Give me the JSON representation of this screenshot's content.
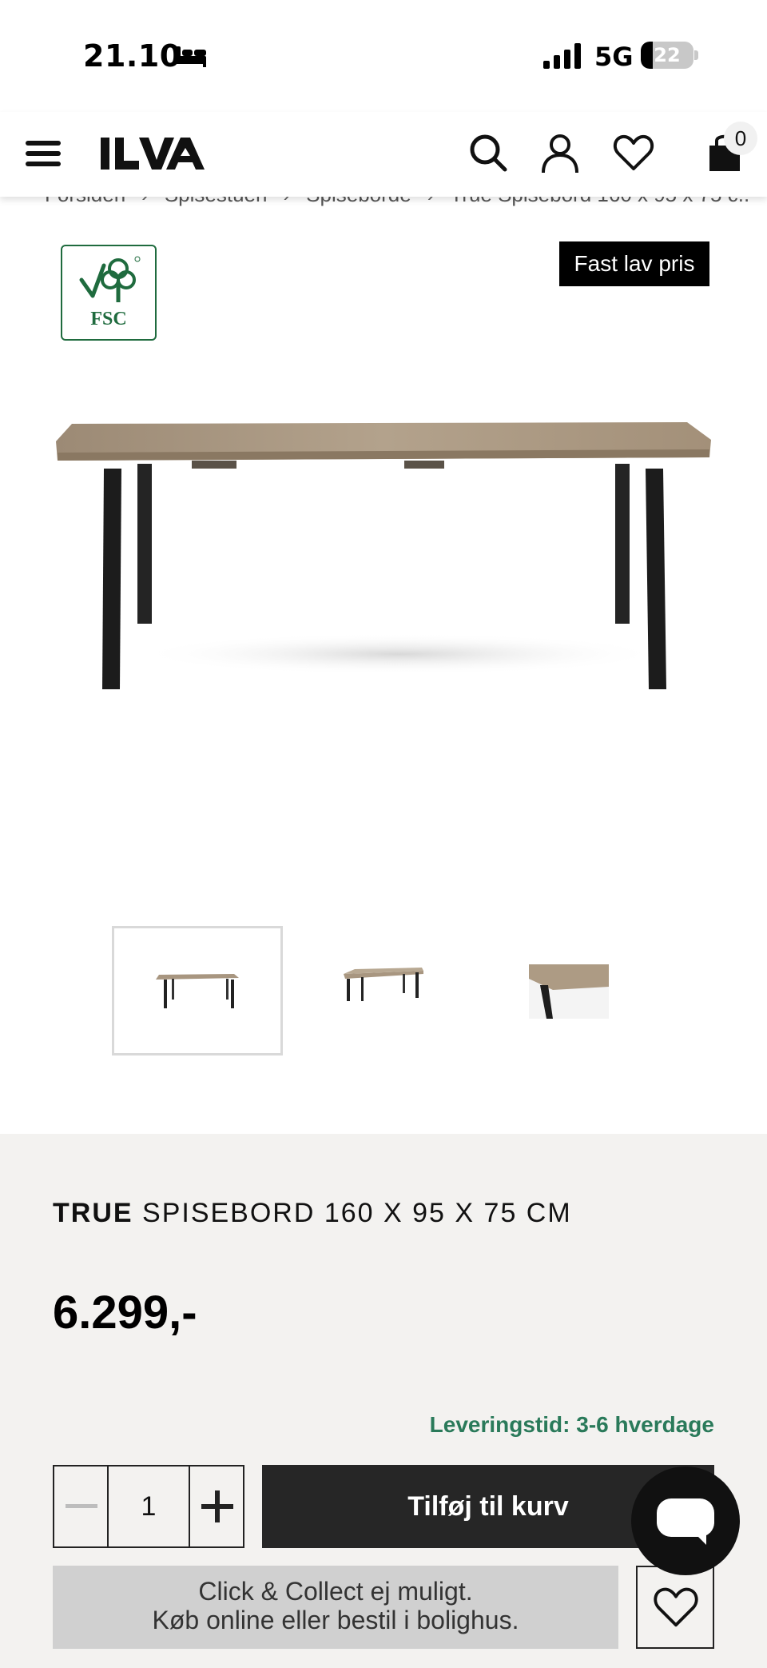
{
  "status_bar": {
    "time": "21.10",
    "network": "5G",
    "battery": "22",
    "battery_level": 0.22
  },
  "header": {
    "brand": "ILVA",
    "cart_count": "0"
  },
  "breadcrumb": [
    "Forsiden",
    "Spisestuen",
    "Spiseborde",
    "True Spisebord 160 x 95 x 75 c..."
  ],
  "product": {
    "certification": "FSC",
    "badge": "Fast lav pris",
    "brand": "TRUE",
    "name": "SPISEBORD 160 X 95 X 75 CM",
    "price": "6.299,-",
    "delivery": "Leveringstid: 3-6 hverdage",
    "quantity": "1",
    "add_to_cart": "Tilføj til kurv",
    "click_collect_line1": "Click & Collect ej muligt.",
    "click_collect_line2": "Køb online eller bestil i bolighus."
  },
  "colors": {
    "accent_green": "#2a7a5a",
    "button_dark": "#262626",
    "info_bg": "#f3f2f0"
  },
  "icons": [
    "hamburger-icon",
    "search-icon",
    "account-icon",
    "heart-icon",
    "shopping-bag-icon",
    "chat-icon"
  ]
}
